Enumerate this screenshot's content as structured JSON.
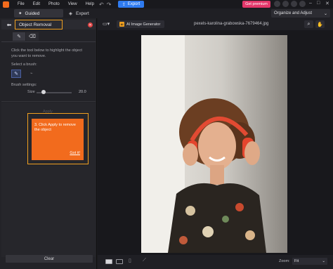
{
  "menu": [
    "File",
    "Edit",
    "Photo",
    "View",
    "Help"
  ],
  "export_label": "Export",
  "premium_label": "Get premium",
  "modes": {
    "guided": "Guided",
    "expert": "Expert"
  },
  "organize_label": "Organize and Adjust",
  "panel": {
    "title": "Object Removal",
    "instruction": "Click the tool below to highlight the object you want to remove.",
    "select_brush": "Select a brush:",
    "brush_settings": "Brush settings:",
    "size_label": "Size",
    "size_value": "20.0",
    "size_fraction": 0.2,
    "apply_faint": "Apply",
    "tooltip_text": "3. Click Apply to remove the object",
    "tooltip_gotit": "Got it!",
    "clear_label": "Clear"
  },
  "workspace": {
    "ai_label": "AI Image Generator",
    "filename": "pexels-karolina-grabowska-7679464.jpg",
    "zoom_label": "Zoom:",
    "zoom_value": "Fit"
  },
  "colors": {
    "accent_orange": "#f26b1d",
    "highlight_outline": "#f0a020",
    "export_blue": "#2f7bf0",
    "premium_pink": "#e2376a"
  },
  "icons": [
    "app-logo-icon",
    "undo-icon",
    "redo-icon",
    "export-icon",
    "guided-wand-icon",
    "expert-layers-icon",
    "back-arrow-icon",
    "close-icon",
    "brush-tab-icon",
    "eraser-tab-icon",
    "brush-icon",
    "folder-icon",
    "ai-badge-icon",
    "search-zoom-icon",
    "hand-tool-icon",
    "single-view-icon",
    "compare-view-icon",
    "crop-icon",
    "chevron-down-icon"
  ]
}
